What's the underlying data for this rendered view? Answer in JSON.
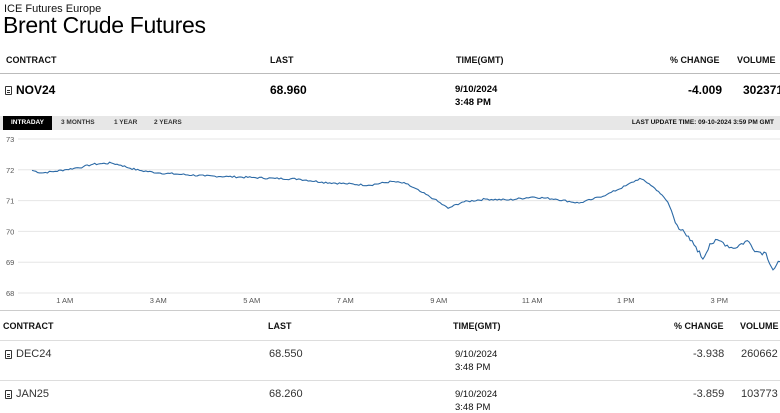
{
  "header": {
    "exchange": "ICE Futures Europe",
    "title": "Brent Crude Futures"
  },
  "top_table": {
    "columns": [
      "CONTRACT",
      "LAST",
      "TIME(GMT)",
      "% CHANGE",
      "VOLUME"
    ],
    "row": {
      "contract": "NOV24",
      "last": "68.960",
      "date": "9/10/2024",
      "time": "3:48 PM",
      "change": "-4.009",
      "volume": "302371"
    }
  },
  "tabs": [
    "INTRADAY",
    "3 MONTHS",
    "1 YEAR",
    "2 YEARS"
  ],
  "active_tab": "INTRADAY",
  "last_update": "LAST UPDATE TIME: 09-10-2024 3:59 PM GMT",
  "bottom_table": {
    "columns": [
      "CONTRACT",
      "LAST",
      "TIME(GMT)",
      "% CHANGE",
      "VOLUME"
    ],
    "rows": [
      {
        "contract": "DEC24",
        "last": "68.550",
        "date": "9/10/2024",
        "time": "3:48 PM",
        "change": "-3.938",
        "volume": "260662"
      },
      {
        "contract": "JAN25",
        "last": "68.260",
        "date": "9/10/2024",
        "time": "3:48 PM",
        "change": "-3.859",
        "volume": "103773"
      }
    ]
  },
  "colors": {
    "line": "#2c6aa6",
    "grid": "#e6e6e6",
    "tab_active": "#000000",
    "tab_bar": "#e7e7e7"
  },
  "chart_data": {
    "type": "line",
    "x_unit": "hours GMT",
    "x_ticks": [
      1,
      3,
      5,
      7,
      9,
      11,
      13,
      15
    ],
    "x_tick_labels": [
      "1 AM",
      "3 AM",
      "5 AM",
      "7 AM",
      "9 AM",
      "11 AM",
      "1 PM",
      "3 PM"
    ],
    "y_ticks": [
      68,
      69,
      70,
      71,
      72,
      73
    ],
    "ylim": [
      68,
      73
    ],
    "xlim": [
      0,
      16.3
    ],
    "grid": true,
    "series": [
      {
        "x": [
          0.3,
          0.5,
          0.8,
          1.0,
          1.2,
          1.4,
          1.6,
          1.8,
          2.0,
          2.2,
          2.4,
          2.6,
          3.0,
          3.5,
          4.0,
          4.5,
          5.0,
          5.5,
          6.0,
          6.5,
          7.0,
          7.5,
          8.0,
          8.3,
          8.6,
          8.9,
          9.2,
          9.5,
          10.0,
          10.5,
          11.0,
          11.5,
          12.0,
          12.3,
          12.6,
          13.0,
          13.3,
          13.5,
          13.7,
          13.9,
          14.1,
          14.3,
          14.5,
          14.65,
          14.8,
          15.0,
          15.3,
          15.6,
          15.8,
          16.0,
          16.15,
          16.3
        ],
        "y": [
          71.98,
          71.9,
          71.95,
          72.0,
          72.05,
          72.1,
          72.18,
          72.2,
          72.22,
          72.15,
          72.05,
          71.98,
          71.9,
          71.85,
          71.8,
          71.78,
          71.75,
          71.72,
          71.7,
          71.6,
          71.55,
          71.5,
          71.62,
          71.55,
          71.3,
          71.05,
          70.75,
          70.95,
          71.05,
          71.02,
          71.12,
          71.05,
          70.92,
          71.05,
          71.2,
          71.48,
          71.72,
          71.55,
          71.3,
          70.95,
          70.2,
          69.85,
          69.5,
          69.1,
          69.6,
          69.7,
          69.45,
          69.7,
          69.35,
          69.3,
          68.75,
          69.02
        ]
      }
    ]
  }
}
